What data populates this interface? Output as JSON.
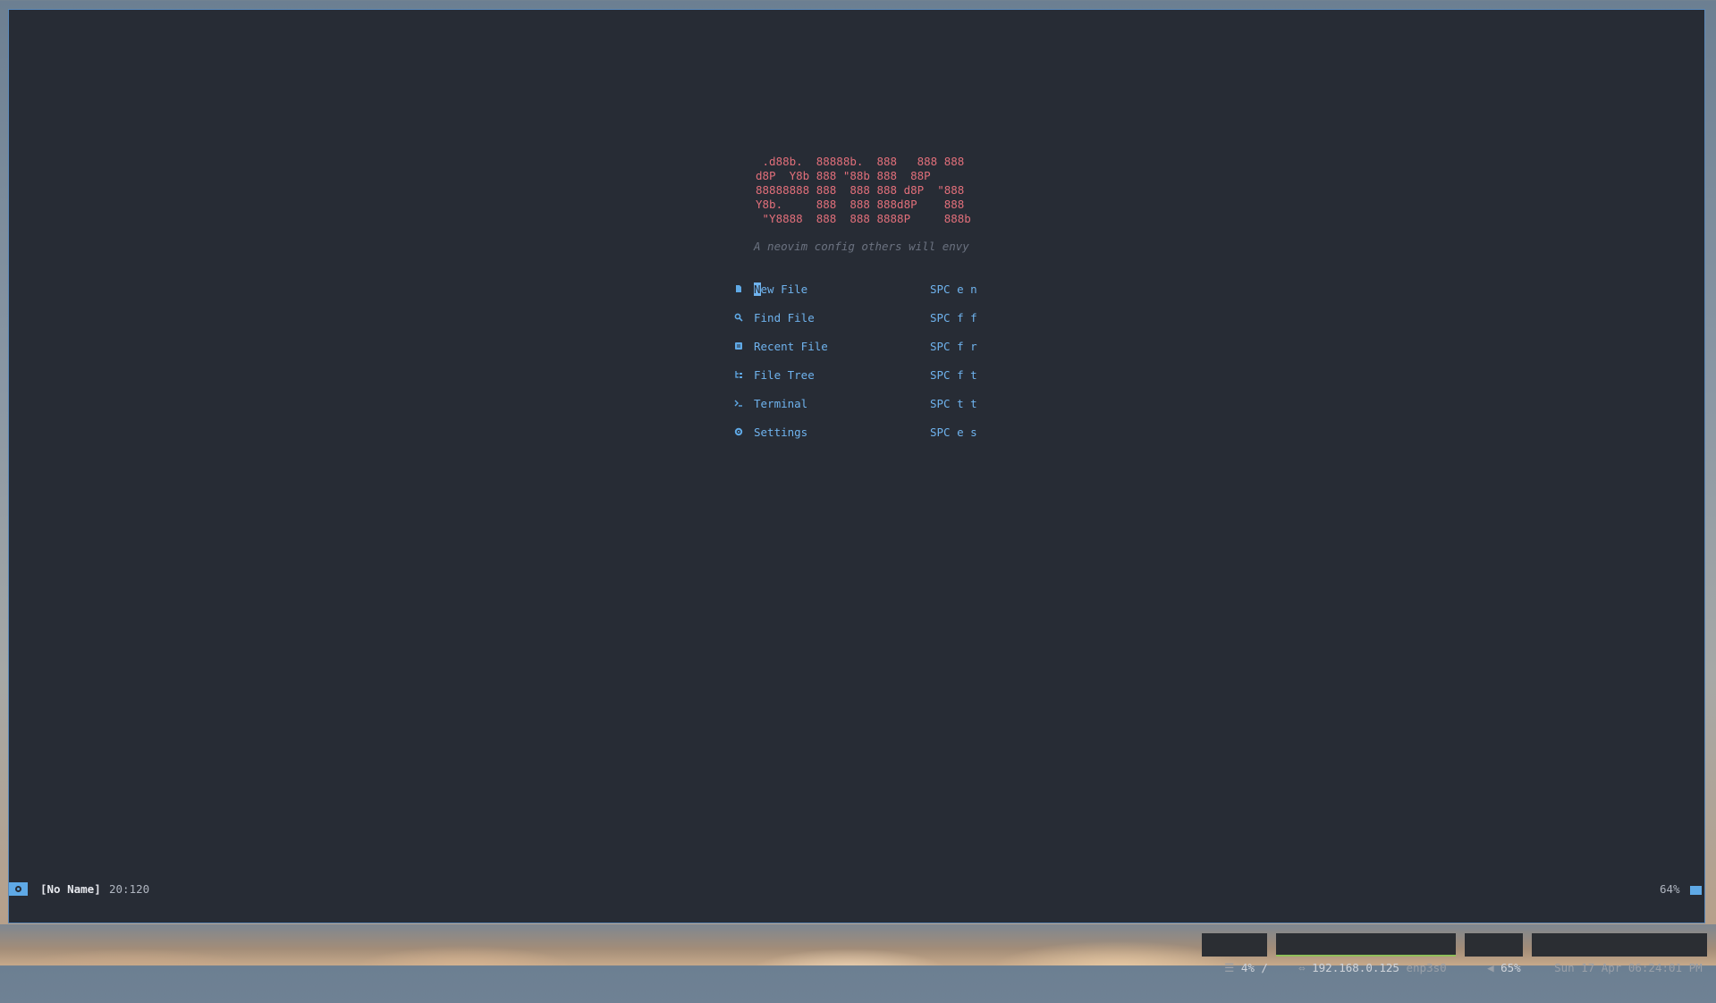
{
  "dashboard": {
    "logo_lines": [
      " .d88b.  88888b.  888   888 888",
      "d8P  Y8b 888 \"88b 888  88P",
      "88888888 888  888 888 d8P  \"888",
      "Y8b.     888  888 888d8P    888",
      " \"Y8888  888  888 8888P     888b"
    ],
    "tagline": "A neovim config others will envy",
    "items": [
      {
        "icon": "new-file-icon",
        "label": "New File",
        "key": "SPC e n"
      },
      {
        "icon": "search-icon",
        "label": "Find File",
        "key": "SPC f f"
      },
      {
        "icon": "recent-file-icon",
        "label": "Recent File",
        "key": "SPC f r"
      },
      {
        "icon": "file-tree-icon",
        "label": "File Tree",
        "key": "SPC f t"
      },
      {
        "icon": "terminal-icon",
        "label": "Terminal",
        "key": "SPC t t"
      },
      {
        "icon": "gear-icon",
        "label": "Settings",
        "key": "SPC e s"
      }
    ]
  },
  "statusline": {
    "buffer_name": "[No Name]",
    "position": "20:120",
    "percent": "64%"
  },
  "system_bar": {
    "disk": "4% /",
    "ip": "192.168.0.125",
    "interface": "enp3s0",
    "volume": "65%",
    "datetime": "Sun 17 Apr 06:24:01 PM"
  },
  "colors": {
    "background": "#272c35",
    "logo": "#e16f7a",
    "accent": "#5fa9e6"
  }
}
